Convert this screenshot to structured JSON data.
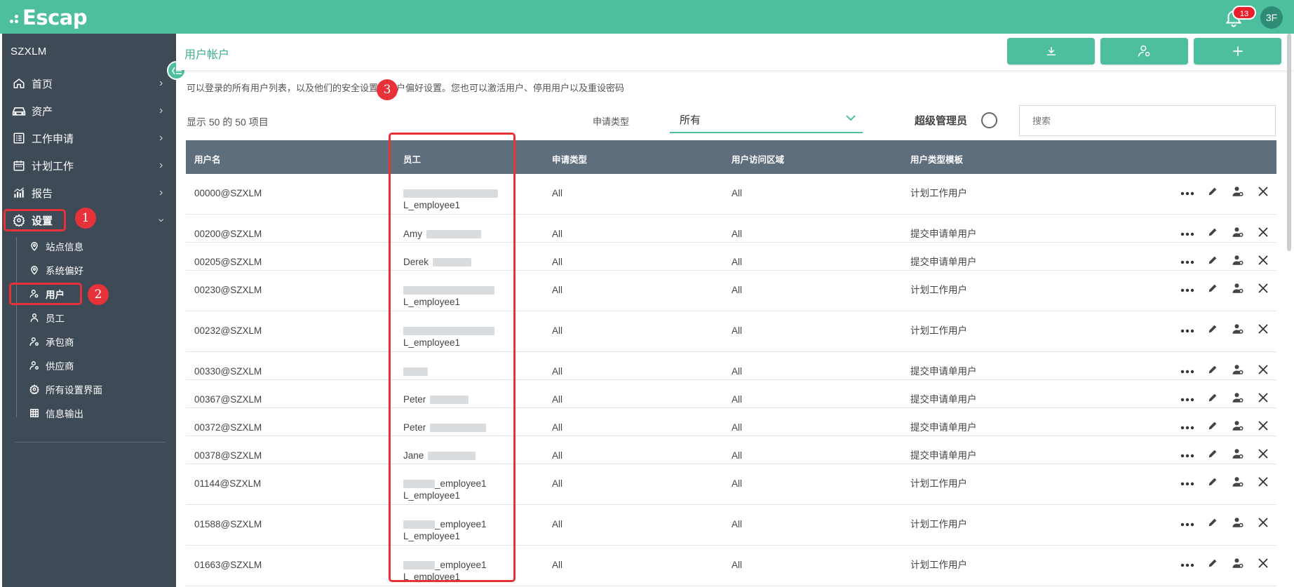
{
  "app": {
    "logo_text": "Escap",
    "notification_count": "13",
    "user_initials": "3F"
  },
  "sidebar": {
    "site_name": "SZXLM",
    "items": [
      {
        "label": "首页",
        "icon": "home-icon"
      },
      {
        "label": "资产",
        "icon": "car-icon"
      },
      {
        "label": "工作申请",
        "icon": "list-icon"
      },
      {
        "label": "计划工作",
        "icon": "calendar-icon"
      },
      {
        "label": "报告",
        "icon": "chart-icon"
      },
      {
        "label": "设置",
        "icon": "gear-icon",
        "expanded": true
      }
    ],
    "sub_items": [
      {
        "label": "站点信息",
        "icon": "location-icon"
      },
      {
        "label": "系统偏好",
        "icon": "location-icon"
      },
      {
        "label": "用户",
        "icon": "user-key-icon",
        "active": true
      },
      {
        "label": "员工",
        "icon": "user-icon"
      },
      {
        "label": "承包商",
        "icon": "user-gear-icon"
      },
      {
        "label": "供应商",
        "icon": "user-gear-icon"
      },
      {
        "label": "所有设置界面",
        "icon": "gear-icon"
      },
      {
        "label": "信息输出",
        "icon": "grid-icon"
      }
    ]
  },
  "callouts": [
    "1",
    "2",
    "3"
  ],
  "header": {
    "title": "用户帐户"
  },
  "description": "可以登录的所有用户列表，以及他们的安全设置和用户偏好设置。您也可以激活用户、停用用户以及重设密码",
  "filters": {
    "count_text": "显示 50 的 50 项目",
    "type_label": "申请类型",
    "type_value": "所有",
    "super_admin_label": "超级管理员",
    "search_placeholder": "搜索"
  },
  "table": {
    "columns": [
      "用户名",
      "员工",
      "申请类型",
      "用户访问区域",
      "用户类型模板"
    ],
    "rows": [
      {
        "username": "00000@SZXLM",
        "employee_line1": "",
        "employee_line2": "L_employee1",
        "type": "All",
        "area": "All",
        "template": "计划工作用户"
      },
      {
        "username": "00200@SZXLM",
        "employee_line1": "Amy",
        "employee_line2": "",
        "type": "All",
        "area": "All",
        "template": "提交申请单用户"
      },
      {
        "username": "00205@SZXLM",
        "employee_line1": "Derek",
        "employee_line2": "",
        "type": "All",
        "area": "All",
        "template": "提交申请单用户"
      },
      {
        "username": "00230@SZXLM",
        "employee_line1": "",
        "employee_line2": "L_employee1",
        "type": "All",
        "area": "All",
        "template": "计划工作用户"
      },
      {
        "username": "00232@SZXLM",
        "employee_line1": "",
        "employee_line2": "L_employee1",
        "type": "All",
        "area": "All",
        "template": "计划工作用户"
      },
      {
        "username": "00330@SZXLM",
        "employee_line1": "",
        "employee_line2": "",
        "type": "All",
        "area": "All",
        "template": "提交申请单用户"
      },
      {
        "username": "00367@SZXLM",
        "employee_line1": "Peter",
        "employee_line2": "",
        "type": "All",
        "area": "All",
        "template": "提交申请单用户"
      },
      {
        "username": "00372@SZXLM",
        "employee_line1": "Peter",
        "employee_line2": "",
        "type": "All",
        "area": "All",
        "template": "提交申请单用户"
      },
      {
        "username": "00378@SZXLM",
        "employee_line1": "Jane",
        "employee_line2": "",
        "type": "All",
        "area": "All",
        "template": "提交申请单用户"
      },
      {
        "username": "01144@SZXLM",
        "employee_line1": "_employee1",
        "employee_line2": "L_employee1",
        "type": "All",
        "area": "All",
        "template": "计划工作用户"
      },
      {
        "username": "01588@SZXLM",
        "employee_line1": "_employee1",
        "employee_line2": "L_employee1",
        "type": "All",
        "area": "All",
        "template": "计划工作用户"
      },
      {
        "username": "01663@SZXLM",
        "employee_line1": "_employee1",
        "employee_line2": "L_employee1",
        "type": "All",
        "area": "All",
        "template": "计划工作用户"
      }
    ]
  },
  "colors": {
    "brand": "#4dbf9f",
    "sidebar": "#3e4a55",
    "table_header": "#5e6e7c",
    "highlight": "#e8323a"
  }
}
